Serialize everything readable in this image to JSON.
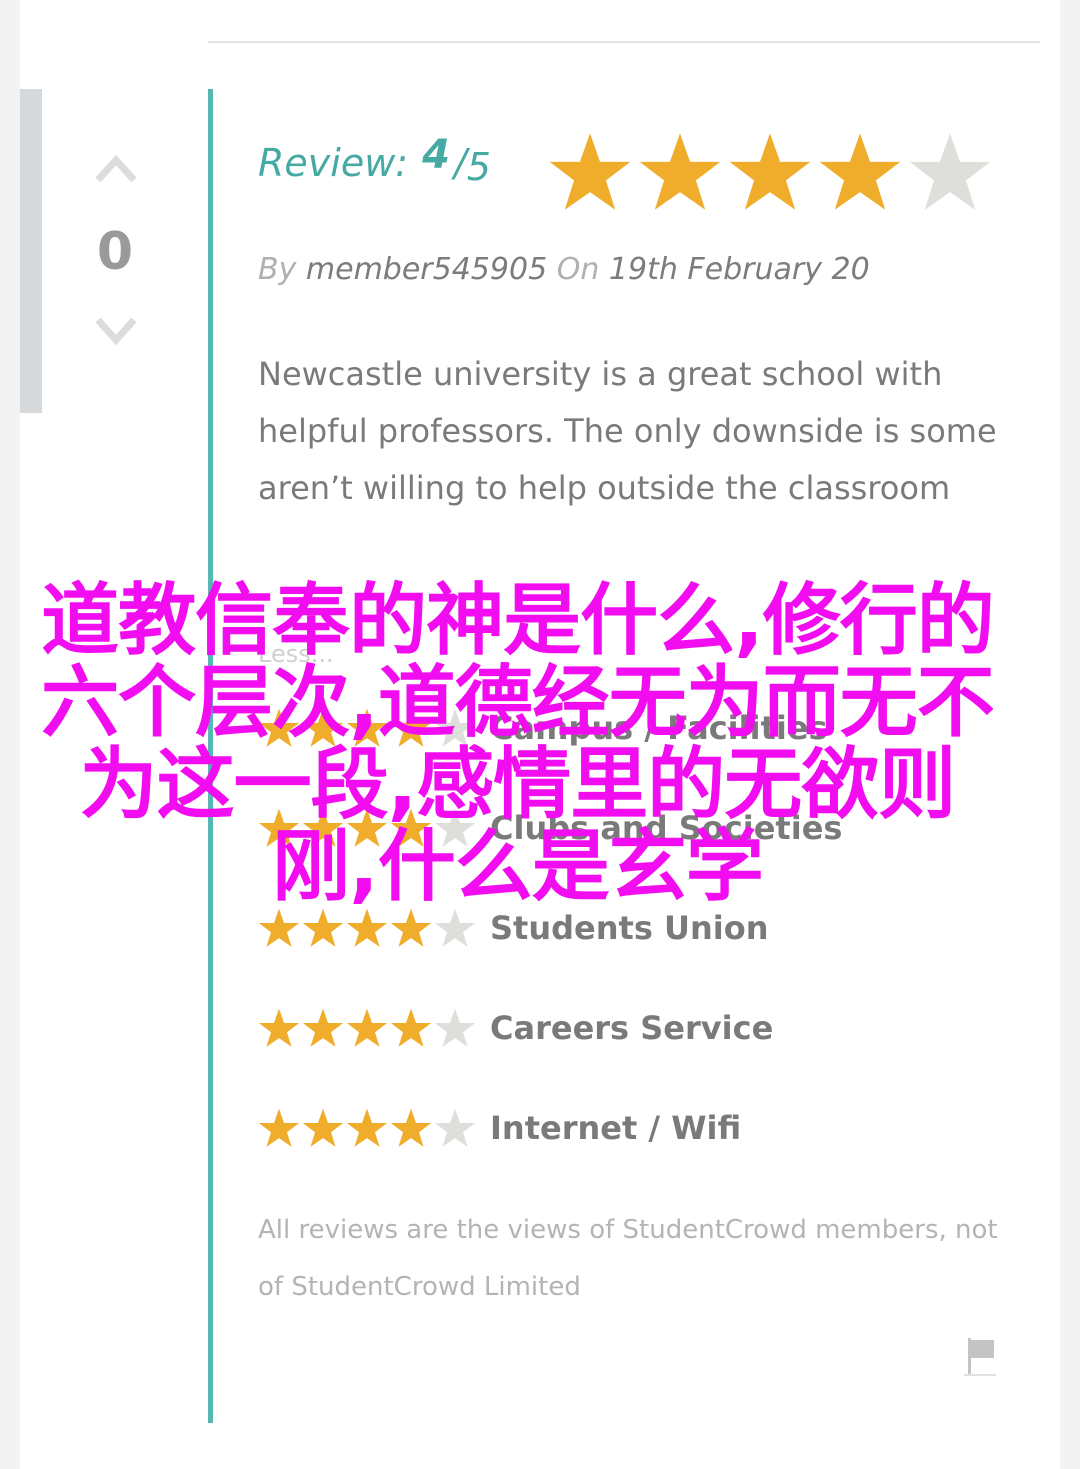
{
  "vote": {
    "count": "0"
  },
  "review": {
    "label": "Review:",
    "score": "4",
    "slash": "/",
    "max": "5",
    "rating": 4,
    "by_label": "By",
    "author": "member545905",
    "on_label": "On",
    "date": "19th February 20",
    "body": "Newcastle university is a great school with helpful professors. The only downside is some aren’t willing to help outside the classroom",
    "less_link": "Less..."
  },
  "ratings": [
    {
      "label": "Campus / Facilities",
      "stars": 4
    },
    {
      "label": "Clubs and Societies",
      "stars": 4
    },
    {
      "label": "Students Union",
      "stars": 4
    },
    {
      "label": "Careers Service",
      "stars": 4
    },
    {
      "label": "Internet / Wifi",
      "stars": 4
    }
  ],
  "disclaimer": "All reviews are the views of StudentCrowd members, not of StudentCrowd Limited",
  "overlay_text": "道教信奉的神是什么,修行的六个层次,道德经无为而无不为这一段,感情里的无欲则刚,什么是玄学",
  "colors": {
    "star_filled": "#f0ad2c",
    "star_empty": "#dededb",
    "accent_teal": "#55b9b1",
    "overlay_magenta": "#f20df0"
  },
  "icons": {
    "vote_up": "chevron-up-icon",
    "vote_down": "chevron-down-icon",
    "flag": "flag-icon",
    "star": "star-icon"
  }
}
